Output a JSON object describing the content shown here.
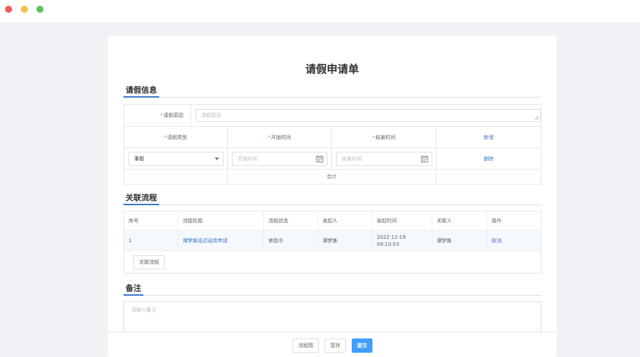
{
  "window": {
    "controls": [
      "close",
      "minimize",
      "maximize"
    ]
  },
  "form": {
    "title": "请假申请单"
  },
  "leave_info": {
    "heading": "请假信息",
    "reason": {
      "label": "请假原因",
      "placeholder": "请假原由"
    },
    "columns": {
      "type": "请假类型",
      "start": "开始时间",
      "end": "结束时间",
      "add": "新增"
    },
    "row": {
      "type_value": "事假",
      "start_placeholder": "开始时间",
      "end_placeholder": "结束时间",
      "delete": "删除"
    },
    "total_label": "合计",
    "required_mark": "*"
  },
  "process": {
    "heading": "关联流程",
    "columns": [
      "序号",
      "流程标题",
      "流程状态",
      "发起人",
      "发起时间",
      "关联人",
      "操作"
    ],
    "rows": [
      {
        "index": "1",
        "title": "谭梦姝延迟返岗申请",
        "status": "审批中",
        "initiator": "谭梦姝",
        "date": "2022-12-19",
        "time": "09:10:03",
        "related": "谭梦姝",
        "action": "取消"
      }
    ],
    "link_button": "关联流程"
  },
  "remarks": {
    "heading": "备注",
    "placeholder": "请输入备注"
  },
  "footer": {
    "flowchart": "流程图",
    "save_draft": "暂存",
    "submit": "提交"
  },
  "colors": {
    "accent": "#409eff",
    "link": "#3a78c9",
    "required": "#f56c6c"
  },
  "icons": {
    "date": "calendar-icon",
    "select": "chevron-down-icon"
  }
}
